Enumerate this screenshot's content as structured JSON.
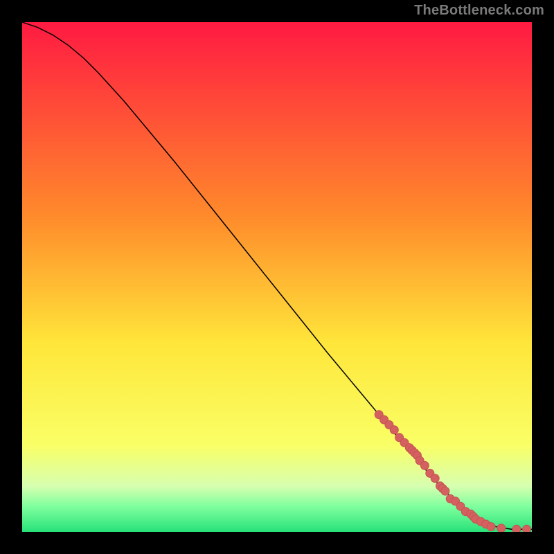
{
  "watermark": "TheBottleneck.com",
  "colors": {
    "gradient_top": "#ff1a42",
    "gradient_mid1": "#ff8a2b",
    "gradient_mid2": "#ffe63a",
    "gradient_mid3": "#f9ff66",
    "gradient_green1": "#d7ffb0",
    "gradient_green2": "#7fff9e",
    "gradient_green3": "#28e27a",
    "line": "#000000",
    "marker_fill": "#d46060",
    "marker_stroke": "#c55252",
    "page_bg": "#000000"
  },
  "chart_data": {
    "type": "line",
    "title": "",
    "xlabel": "",
    "ylabel": "",
    "xlim": [
      0,
      100
    ],
    "ylim": [
      0,
      100
    ],
    "series": [
      {
        "name": "curve",
        "x": [
          0,
          3,
          6,
          9,
          12,
          15,
          20,
          30,
          40,
          50,
          60,
          70,
          78,
          82,
          85,
          88,
          90,
          93,
          96,
          100
        ],
        "y": [
          100,
          99,
          97.5,
          95.5,
          93,
          90,
          84.5,
          72.5,
          60,
          47.5,
          35,
          23,
          13.5,
          9,
          6,
          3.5,
          2,
          1,
          0.5,
          0.5
        ]
      }
    ],
    "markers": {
      "name": "points",
      "x": [
        70,
        71,
        72,
        73,
        74,
        75,
        76,
        76.5,
        77,
        77.5,
        78,
        79,
        80,
        81,
        82,
        82.5,
        83,
        84,
        85,
        86,
        87,
        88,
        88.5,
        89,
        90,
        91,
        92,
        94,
        97,
        99
      ],
      "y": [
        23,
        22,
        21,
        20,
        18.5,
        17.5,
        16.5,
        16,
        15.5,
        15,
        14,
        13,
        11.5,
        10.5,
        9,
        8.5,
        8,
        6.5,
        6,
        5,
        4,
        3.5,
        3,
        2.5,
        2,
        1.5,
        1,
        0.7,
        0.5,
        0.5
      ]
    }
  }
}
